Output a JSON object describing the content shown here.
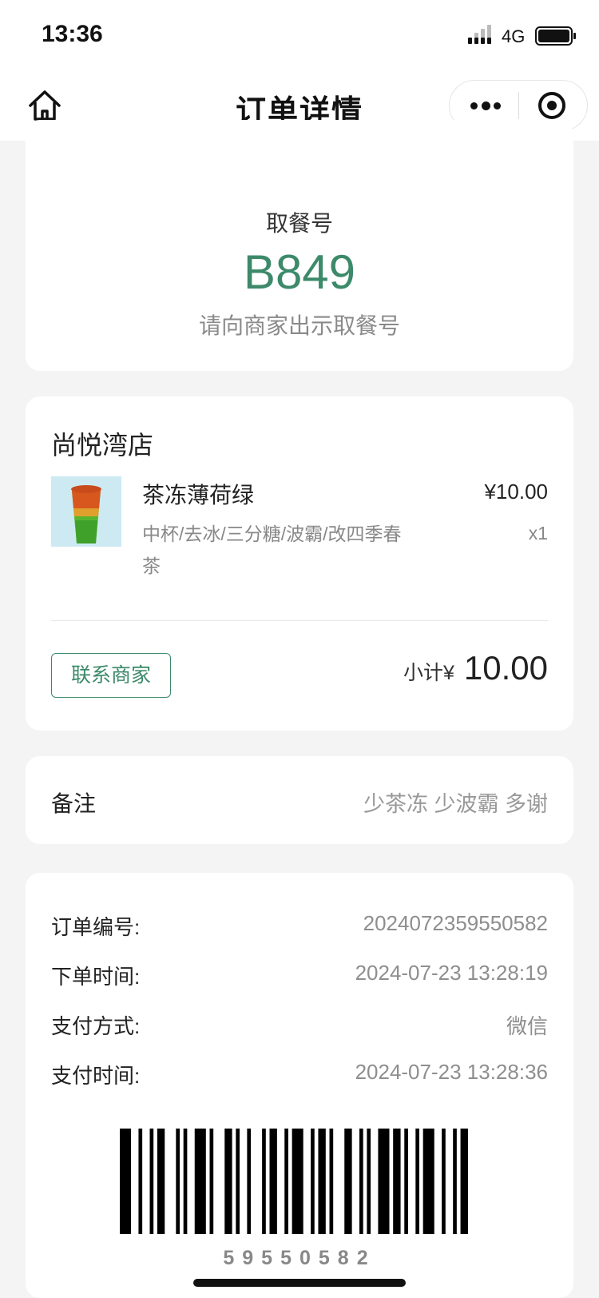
{
  "status_bar": {
    "time": "13:36",
    "network": "4G"
  },
  "nav": {
    "title": "订单详情"
  },
  "pickup": {
    "label": "取餐号",
    "number": "B849",
    "hint": "请向商家出示取餐号"
  },
  "order": {
    "store_name": "尚悦湾店",
    "item": {
      "name": "茶冻薄荷绿",
      "price": "¥10.00",
      "spec": "中杯/去冰/三分糖/波霸/改四季春茶",
      "qty": "x1"
    },
    "contact_label": "联系商家",
    "subtotal_label": "小计¥",
    "subtotal_value": "10.00"
  },
  "remark": {
    "label": "备注",
    "value": "少茶冻 少波霸 多谢"
  },
  "info": {
    "order_no_label": "订单编号:",
    "order_no": "2024072359550582",
    "order_time_label": "下单时间:",
    "order_time": "2024-07-23 13:28:19",
    "pay_method_label": "支付方式:",
    "pay_method": "微信",
    "pay_time_label": "支付时间:",
    "pay_time": "2024-07-23 13:28:36"
  },
  "barcode": {
    "text": "59550582"
  },
  "colors": {
    "accent": "#3c8a6a",
    "background": "#f4f4f4"
  }
}
